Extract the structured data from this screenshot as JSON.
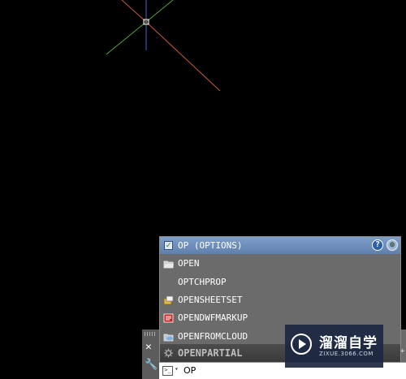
{
  "canvas": {
    "background": "#000000",
    "ucs_colors": {
      "x_axis": "#c85a3a",
      "y_axis": "#5aa03a",
      "z_axis": "#3a6ac8"
    }
  },
  "suggestions": {
    "header": {
      "label": "OP (OPTIONS)",
      "icon": "checkbox-icon"
    },
    "header_buttons": [
      {
        "icon": "help-icon",
        "glyph": "?"
      },
      {
        "icon": "globe-icon",
        "glyph": "◍"
      }
    ],
    "items": [
      {
        "label": "OPEN",
        "icon": "folder-open-icon"
      },
      {
        "label": "OPTCHPROP",
        "icon": ""
      },
      {
        "label": "OPENSHEETSET",
        "icon": "sheetset-icon"
      },
      {
        "label": "OPENDWFMARKUP",
        "icon": "dwf-markup-icon"
      },
      {
        "label": "OPENFROMCLOUD",
        "icon": "cloud-open-icon"
      },
      {
        "label": "OPENPARTIAL",
        "icon": "gear-icon"
      }
    ]
  },
  "command_line": {
    "value": "OP",
    "close_glyph": "✕",
    "customize_glyph": "🔧",
    "side_glyph": "+"
  },
  "watermark": {
    "name": "溜溜自学",
    "url": "ZIXUE.3066.COM"
  }
}
